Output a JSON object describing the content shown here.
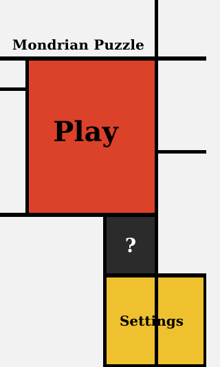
{
  "app": {
    "title": "Mondrian Puzzle"
  },
  "menu": {
    "play_label": "Play",
    "help_label": "?",
    "settings_label": "Settings"
  },
  "colors": {
    "background": "#f2f2f2",
    "grid_line": "#000000",
    "play_red": "#dc4229",
    "help_black": "#2b2b2b",
    "settings_yellow": "#efc12e"
  }
}
